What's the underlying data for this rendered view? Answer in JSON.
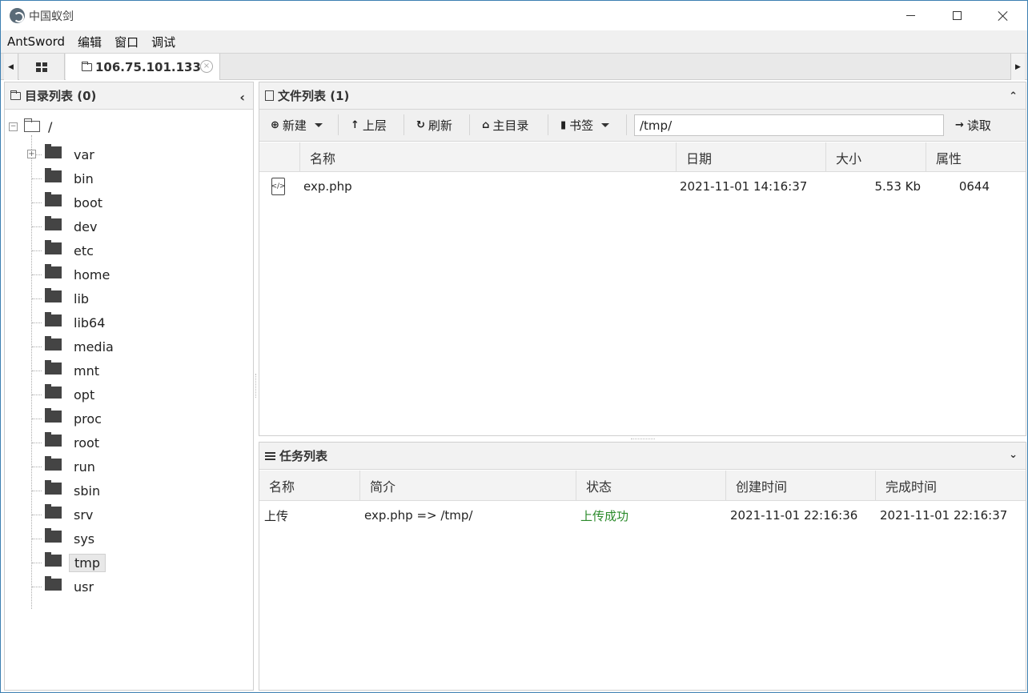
{
  "window": {
    "title": "中国蚁剑"
  },
  "menubar": {
    "items": [
      "AntSword",
      "编辑",
      "窗口",
      "调试"
    ]
  },
  "tabs": {
    "active_label": "106.75.101.133",
    "close_glyph": "×"
  },
  "directory_panel": {
    "title": "目录列表 (0)",
    "root": "/",
    "expander_collapsed": "+",
    "expander_expanded": "−",
    "folders": [
      "var",
      "bin",
      "boot",
      "dev",
      "etc",
      "home",
      "lib",
      "lib64",
      "media",
      "mnt",
      "opt",
      "proc",
      "root",
      "run",
      "sbin",
      "srv",
      "sys",
      "tmp",
      "usr"
    ],
    "selected": "tmp"
  },
  "file_panel": {
    "title": "文件列表 (1)",
    "toolbar": {
      "new_label": "新建",
      "up_label": "上层",
      "refresh_label": "刷新",
      "home_label": "主目录",
      "bookmark_label": "书签",
      "path_value": "/tmp/",
      "read_label": "读取"
    },
    "columns": [
      "名称",
      "日期",
      "大小",
      "属性"
    ],
    "rows": [
      {
        "name": "exp.php",
        "date": "2021-11-01 14:16:37",
        "size": "5.53 Kb",
        "perm": "0644"
      }
    ]
  },
  "task_panel": {
    "title": "任务列表",
    "columns": [
      "名称",
      "简介",
      "状态",
      "创建时间",
      "完成时间"
    ],
    "rows": [
      {
        "name": "上传",
        "desc": "exp.php => /tmp/",
        "status": "上传成功",
        "created": "2021-11-01 22:16:36",
        "finished": "2021-11-01 22:16:37"
      }
    ]
  },
  "colors": {
    "status_success": "#2a8a2a",
    "window_border": "#3c7fb1"
  },
  "icons": {
    "app": "antsword-logo-icon",
    "php_file": "code-file-icon"
  }
}
